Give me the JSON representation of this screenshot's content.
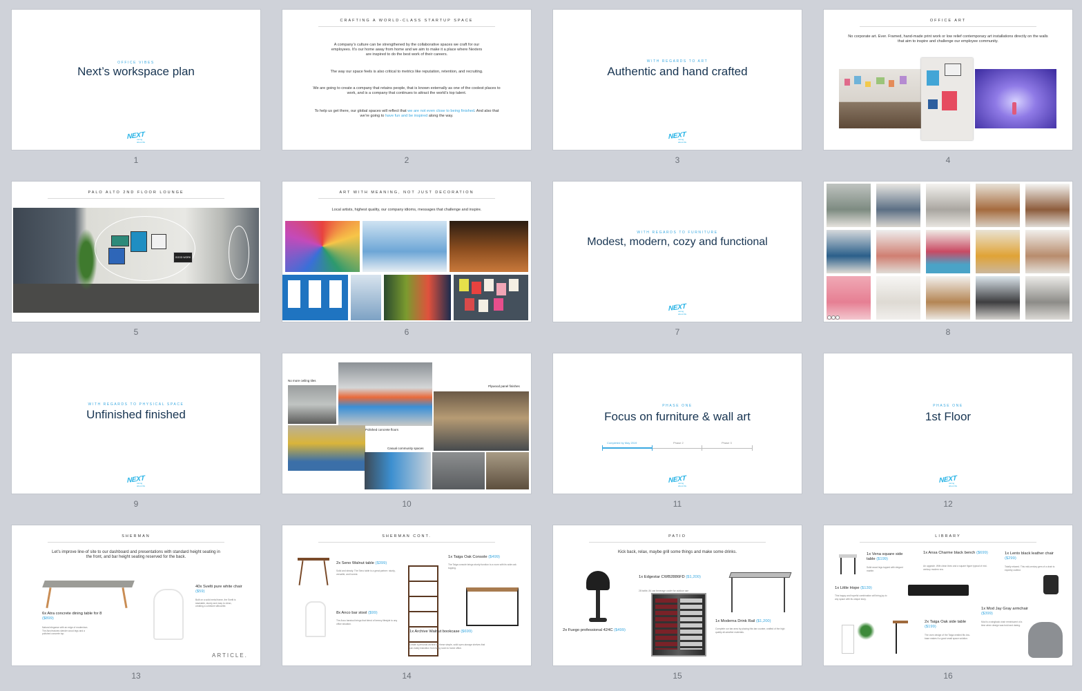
{
  "slides": {
    "s1": {
      "num": "1",
      "kicker": "OFFICE VIBES",
      "title": "Next’s workspace plan",
      "logo": "NEXT",
      "logo_sub": "caring about life"
    },
    "s2": {
      "num": "2",
      "heading": "CRAFTING A WORLD-CLASS STARTUP SPACE",
      "p1": "A company’s culture can be strengthened by the collaborative spaces we craft for our employees. It’s our home away from home and we aim to make it a place where Nexters are inspired to do the best work of their careers.",
      "p2": "The way our space feels is also critical to metrics like reputation, retention, and recruiting.",
      "p3": "We are going to create a company that retains people, that is known externally as one of the coolest places to work, and is a company that continues to attract the world’s top talent.",
      "p4a": "To help us get there, our global spaces will reflect that ",
      "p4b": "we are not even close to being finished",
      "p4c": ".  And also that we’re going to ",
      "p4d": "have fun and be inspired",
      "p4e": " along the way."
    },
    "s3": {
      "num": "3",
      "kicker": "WITH REGARDS TO ART",
      "title": "Authentic and hand crafted",
      "logo": "NEXT",
      "logo_sub": "caring about life"
    },
    "s4": {
      "num": "4",
      "heading": "OFFICE ART",
      "body": "No corporate art. Ever. Framed, hand-made print work or low relief contemporary art installations directly on the walls that aim to inspire and challenge our employee community."
    },
    "s5": {
      "num": "5",
      "heading": "PALO ALTO 2ND FLOOR LOUNGE",
      "sign": "GOOD WORK"
    },
    "s6": {
      "num": "6",
      "heading": "ART WITH MEANING, NOT JUST DECORATION",
      "body": "Local artists, highest quality, our company idioms, messages that challenge and inspire."
    },
    "s7": {
      "num": "7",
      "kicker": "WITH REGARDS TO FURNITURE",
      "title": "Modest, modern, cozy and functional",
      "logo": "NEXT",
      "logo_sub": "caring about life"
    },
    "s8": {
      "num": "8"
    },
    "s9": {
      "num": "9",
      "kicker": "WITH REGARDS TO PHYSICAL SPACE",
      "title": "Unfinished finished",
      "logo": "NEXT",
      "logo_sub": "caring about life"
    },
    "s10": {
      "num": "10",
      "l1": "No more ceiling tiles",
      "l2": "Plywood panel finishes",
      "l3": "Polished concrete floors",
      "l4": "Casual community spaces"
    },
    "s11": {
      "num": "11",
      "kicker": "PHASE ONE",
      "title": "Focus on furniture & wall art",
      "t1": "Completed by May 2019",
      "t2": "Phase 2",
      "t3": "Phase 3",
      "logo": "NEXT",
      "logo_sub": "caring about life"
    },
    "s12": {
      "num": "12",
      "kicker": "PHASE ONE",
      "title": "1st Floor",
      "logo": "NEXT",
      "logo_sub": "caring about life"
    },
    "s13": {
      "num": "13",
      "heading": "SHERMAN",
      "body": "Let’s improve line-of site to our dashboard and presentations with standard height seating in the front, and bar height seating reserved for the back.",
      "p1n": "6x Atra concrete dining table for 8",
      "p1p": "($899)",
      "p1d": "Natural elegance with an edge of modernism. The Atra features slender wood legs and a polished concrete top.",
      "p2n": "40x Svelti pure white chair",
      "p2p": "($59)",
      "p2d": "Built on a solid metal frame, the Svelti is stackable, sturdy and easy to clean, creating a cohesive silhouette.",
      "brand": "ARTICLE."
    },
    "s14": {
      "num": "14",
      "heading": "SHERMAN CONT.",
      "a1n": "2x Seno Walnut table",
      "a1p": "($399)",
      "a1d": "Solid and steady. The Seno table is a great partner: sturdy, versatile, and honest.",
      "a2n": "8x Anco bar stool",
      "a2p": "($99)",
      "a2d": "The Anco barstool brings that blend of breezy lifestyle to any office situation.",
      "a3n": "1x Taiga Oak Console",
      "a3p": "($499)",
      "a3d": "The Taiga console brings sturdy function to a room with its wide oak topping.",
      "a4n": "1x Archive Walnut bookcase",
      "a4p": "($699)",
      "a4d": "Create a personal archive on these simple, solid open-storage shelves that can easily transition from living room to home office."
    },
    "s15": {
      "num": "15",
      "heading": "PATIO",
      "body": "Kick back, relax, maybe grill some things and make some drinks.",
      "b1n": "1x Edgestar CWB2886FD",
      "b1p": "($1,200)",
      "b1d": "28 bottle, 84 can beverage cooler for outdoor use",
      "b2n": "2x Fuego professional 424C",
      "b2p": "($499)",
      "b3n": "1x Moderna Drink Rail",
      "b3p": "($1,200)",
      "b3d": "Complete our bar area by placing this bar counter, crafted of the high quality all-weather materials."
    },
    "s16": {
      "num": "16",
      "heading": "LIBRARY",
      "c1n": "1x Vena square side table",
      "c1p": "($199)",
      "c1d": "Solid wood legs topped with elegant marble.",
      "c2n": "1x Ansa Charme black bench",
      "c2p": "($699)",
      "c2d": "An upgrade. With clean lines and a square figure typical of mid-century modern era.",
      "c3n": "1x Lento black leather chair",
      "c3p": "($299)",
      "c3d": "Totally relaxed. This mid-century gem of a chair is expertly crafted.",
      "c4n": "1x Little Hope",
      "c4p": "($139)",
      "c4d": "This happy and hopeful combination will bring joy to any space with its unique story.",
      "c5n": "2x Taiga Oak side table",
      "c5p": "($199)",
      "c5d": "The oven design of the Taiga nestled fits low-base makes it a good small space solution.",
      "c6n": "1x Mod Jay Gray armchair",
      "c6p": "($399)",
      "c6d": "Mod is a wingback chair reminiscent of a time when design was bold and daring."
    }
  },
  "colors": {
    "accent": "#39a8e0",
    "title": "#173451",
    "background": "#cfd2d9"
  }
}
